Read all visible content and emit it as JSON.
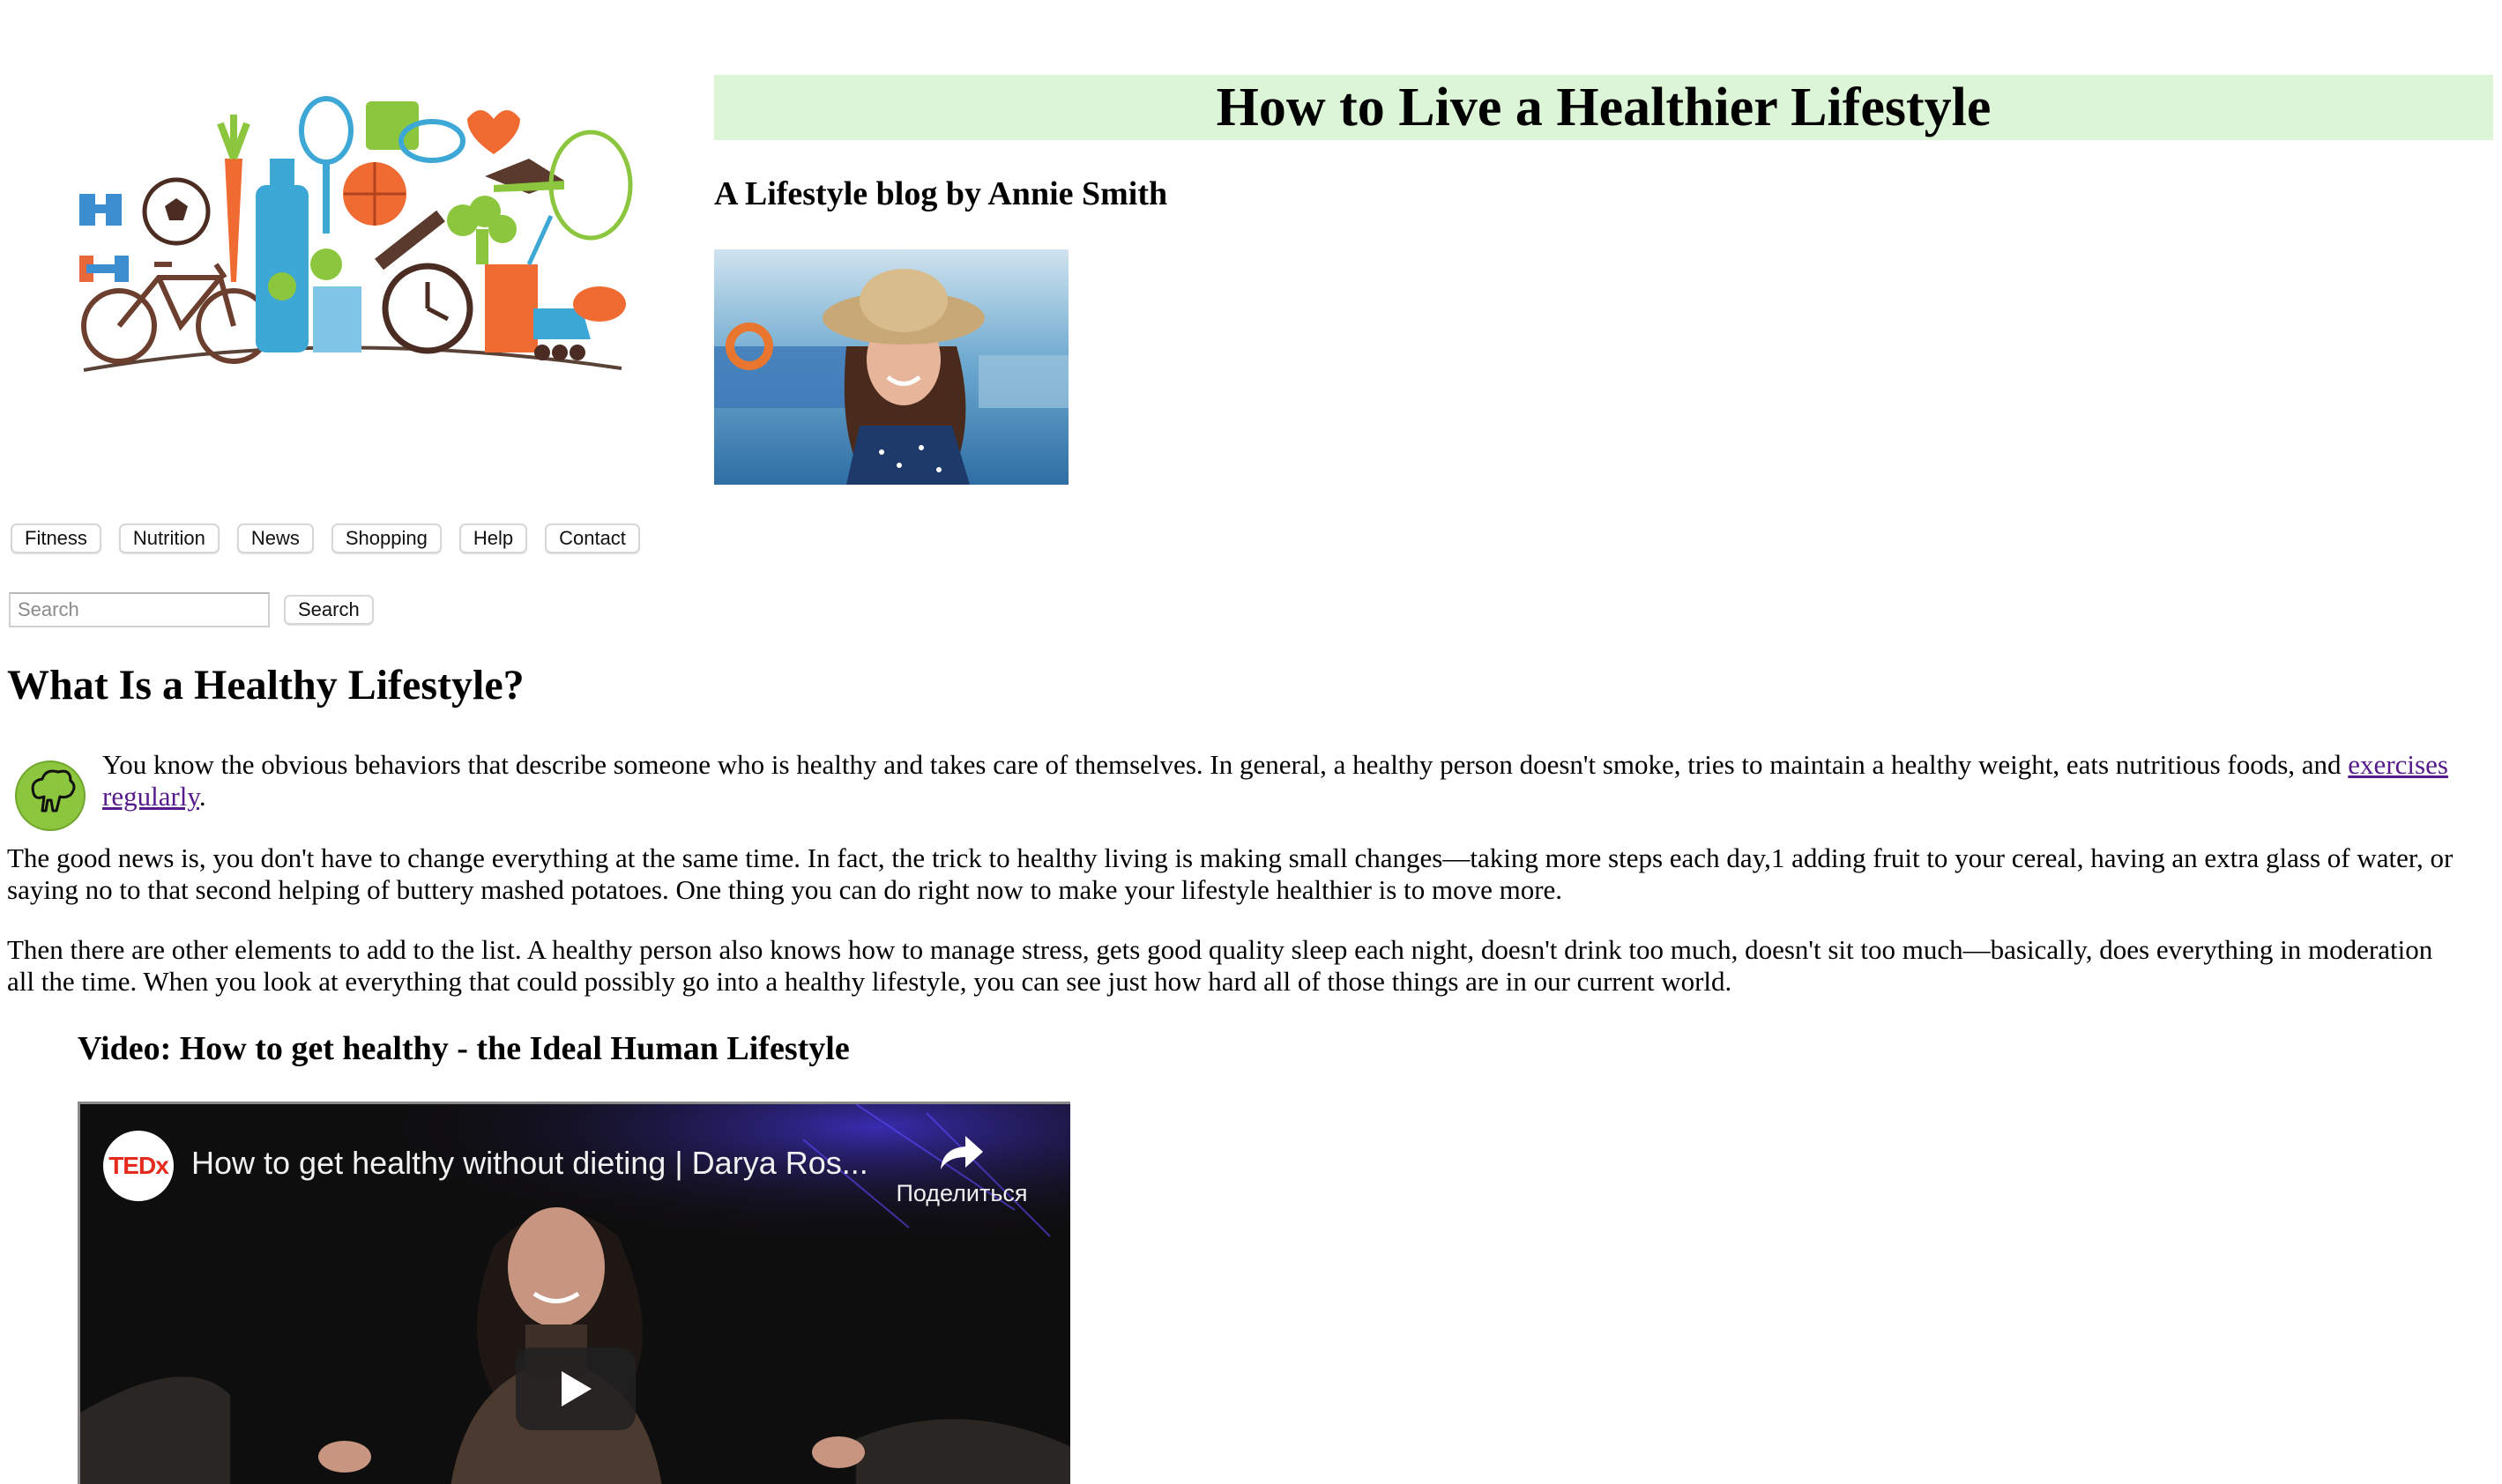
{
  "header": {
    "title": "How to Live a Healthier Lifestyle",
    "byline": "A Lifestyle blog by Annie Smith"
  },
  "nav": {
    "items": [
      {
        "label": "Fitness"
      },
      {
        "label": "Nutrition"
      },
      {
        "label": "News"
      },
      {
        "label": "Shopping"
      },
      {
        "label": "Help"
      },
      {
        "label": "Contact"
      }
    ]
  },
  "search": {
    "placeholder": "Search",
    "value": "",
    "button_label": "Search"
  },
  "article": {
    "heading": "What Is a Healthy Lifestyle?",
    "p1_text": "You know the obvious behaviors that describe someone who is healthy and takes care of themselves. In general, a healthy person doesn't smoke, tries to maintain a healthy weight, eats nutritious foods, and ",
    "p1_link": "exercises regularly",
    "p1_end": ".",
    "p2": "The good news is, you don't have to change everything at the same time. In fact, the trick to healthy living is making small changes—taking more steps each day,1 adding fruit to your cereal, having an extra glass of water, or saying no to that second helping of buttery mashed potatoes. One thing you can do right now to make your lifestyle healthier is to move more.",
    "p3": "Then there are other elements to add to the list. A healthy person also knows how to manage stress, gets good quality sleep each night, doesn't drink too much, doesn't sit too much—basically, does everything in moderation all the time. When you look at everything that could possibly go into a healthy lifestyle, you can see just how hard all of those things are in our current world."
  },
  "video": {
    "heading": "Video: How to get healthy - the Ideal Human Lifestyle",
    "channel_logo": "TEDx",
    "caption": "How to get healthy without dieting | Darya Ros...",
    "share_label": "Поделиться"
  },
  "colors": {
    "title_bg": "#dcf5d6",
    "link": "#551a8b",
    "icon_green": "#8cc63f"
  },
  "icons": [
    "broccoli-icon",
    "share-icon",
    "play-icon"
  ]
}
